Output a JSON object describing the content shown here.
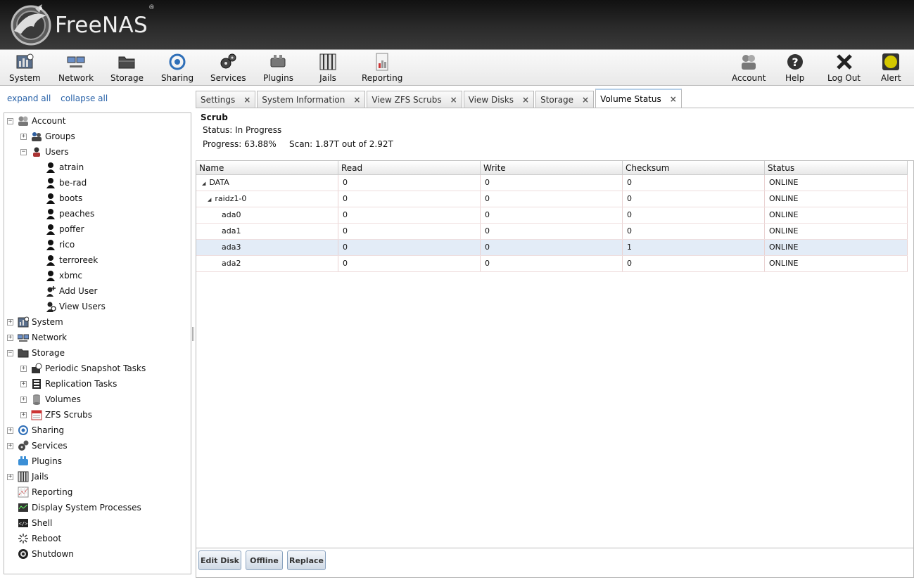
{
  "app": {
    "name": "FreeNAS",
    "reg": "®"
  },
  "toolbar": {
    "left": [
      {
        "label": "System",
        "icon": "system-icon"
      },
      {
        "label": "Network",
        "icon": "network-icon"
      },
      {
        "label": "Storage",
        "icon": "storage-icon"
      },
      {
        "label": "Sharing",
        "icon": "sharing-icon"
      },
      {
        "label": "Services",
        "icon": "services-icon"
      },
      {
        "label": "Plugins",
        "icon": "plugins-icon"
      },
      {
        "label": "Jails",
        "icon": "jails-icon"
      },
      {
        "label": "Reporting",
        "icon": "reporting-icon"
      }
    ],
    "right": [
      {
        "label": "Account",
        "icon": "account-icon"
      },
      {
        "label": "Help",
        "icon": "help-icon"
      },
      {
        "label": "Log Out",
        "icon": "logout-icon"
      },
      {
        "label": "Alert",
        "icon": "alert-icon",
        "color": "#d4c800"
      }
    ]
  },
  "nav": {
    "expand_all": "expand all",
    "collapse_all": "collapse all",
    "tree": [
      {
        "label": "Account",
        "expander": "−",
        "icon": "account-icon"
      },
      {
        "label": "Groups",
        "expander": "+",
        "icon": "groups-icon"
      },
      {
        "label": "Users",
        "expander": "−",
        "icon": "users-icon"
      },
      {
        "label": "atrain",
        "icon": "user-icon"
      },
      {
        "label": "be-rad",
        "icon": "user-icon"
      },
      {
        "label": "boots",
        "icon": "user-icon"
      },
      {
        "label": "peaches",
        "icon": "user-icon"
      },
      {
        "label": "poffer",
        "icon": "user-icon"
      },
      {
        "label": "rico",
        "icon": "user-icon"
      },
      {
        "label": "terroreek",
        "icon": "user-icon"
      },
      {
        "label": "xbmc",
        "icon": "user-icon"
      },
      {
        "label": "Add User",
        "icon": "add-user-icon"
      },
      {
        "label": "View Users",
        "icon": "view-users-icon"
      },
      {
        "label": "System",
        "expander": "+",
        "icon": "system-icon"
      },
      {
        "label": "Network",
        "expander": "+",
        "icon": "network-icon"
      },
      {
        "label": "Storage",
        "expander": "−",
        "icon": "storage-icon"
      },
      {
        "label": "Periodic Snapshot Tasks",
        "expander": "+",
        "icon": "snapshot-icon"
      },
      {
        "label": "Replication Tasks",
        "expander": "+",
        "icon": "replication-icon"
      },
      {
        "label": "Volumes",
        "expander": "+",
        "icon": "volumes-icon"
      },
      {
        "label": "ZFS Scrubs",
        "expander": "+",
        "icon": "calendar-icon"
      },
      {
        "label": "Sharing",
        "expander": "+",
        "icon": "sharing-icon"
      },
      {
        "label": "Services",
        "expander": "+",
        "icon": "services-icon"
      },
      {
        "label": "Plugins",
        "icon": "plugins-icon"
      },
      {
        "label": "Jails",
        "expander": "+",
        "icon": "jails-icon"
      },
      {
        "label": "Reporting",
        "icon": "reporting-icon"
      },
      {
        "label": "Display System Processes",
        "icon": "processes-icon"
      },
      {
        "label": "Shell",
        "icon": "shell-icon"
      },
      {
        "label": "Reboot",
        "icon": "reboot-icon"
      },
      {
        "label": "Shutdown",
        "icon": "shutdown-icon"
      }
    ]
  },
  "tabs": [
    {
      "label": "Settings",
      "close": "×"
    },
    {
      "label": "System Information",
      "close": "×"
    },
    {
      "label": "View ZFS Scrubs",
      "close": "×"
    },
    {
      "label": "View Disks",
      "close": "×"
    },
    {
      "label": "Storage",
      "close": "×"
    },
    {
      "label": "Volume Status",
      "close": "×",
      "active": true
    }
  ],
  "scrub": {
    "title": "Scrub",
    "status": "Status: In Progress",
    "progress": "Progress: 63.88%",
    "scan": "Scan: 1.87T out of 2.92T"
  },
  "grid": {
    "columns": [
      "Name",
      "Read",
      "Write",
      "Checksum",
      "Status"
    ],
    "rows": [
      {
        "name": "DATA",
        "toggle": "◢",
        "read": "0",
        "write": "0",
        "checksum": "0",
        "status": "ONLINE"
      },
      {
        "name": "raidz1-0",
        "toggle": "◢",
        "read": "0",
        "write": "0",
        "checksum": "0",
        "status": "ONLINE"
      },
      {
        "name": "ada0",
        "read": "0",
        "write": "0",
        "checksum": "0",
        "status": "ONLINE"
      },
      {
        "name": "ada1",
        "read": "0",
        "write": "0",
        "checksum": "0",
        "status": "ONLINE"
      },
      {
        "name": "ada3",
        "read": "0",
        "write": "0",
        "checksum": "1",
        "status": "ONLINE",
        "selected": true
      },
      {
        "name": "ada2",
        "read": "0",
        "write": "0",
        "checksum": "0",
        "status": "ONLINE"
      }
    ]
  },
  "actions": {
    "edit_disk": "Edit Disk",
    "offline": "Offline",
    "replace": "Replace"
  }
}
